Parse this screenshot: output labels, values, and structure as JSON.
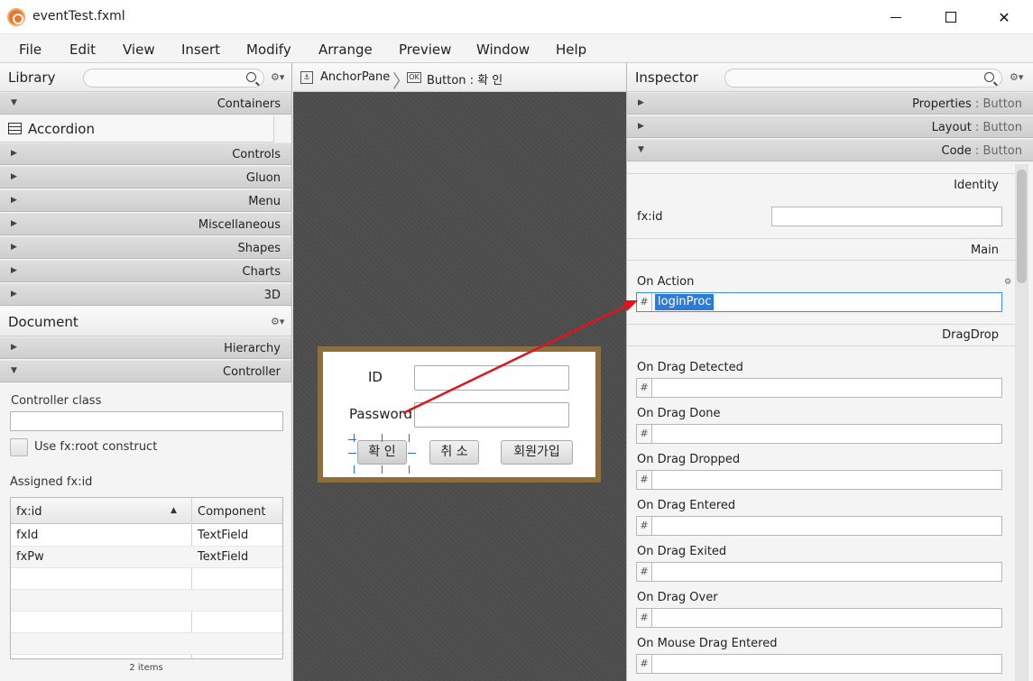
{
  "window": {
    "title": "eventTest.fxml",
    "controls": {
      "minimize": "—",
      "maximize": "☐",
      "close": "✕"
    }
  },
  "menu": [
    "File",
    "Edit",
    "View",
    "Insert",
    "Modify",
    "Arrange",
    "Preview",
    "Window",
    "Help"
  ],
  "library": {
    "title": "Library",
    "sections": [
      {
        "label": "Containers",
        "expanded": true
      },
      {
        "label": "Controls",
        "expanded": false
      },
      {
        "label": "Gluon",
        "expanded": false
      },
      {
        "label": "Menu",
        "expanded": false
      },
      {
        "label": "Miscellaneous",
        "expanded": false
      },
      {
        "label": "Shapes",
        "expanded": false
      },
      {
        "label": "Charts",
        "expanded": false
      },
      {
        "label": "3D",
        "expanded": false
      }
    ],
    "container_item": "Accordion"
  },
  "document": {
    "title": "Document",
    "sections": [
      {
        "label": "Hierarchy",
        "expanded": false
      },
      {
        "label": "Controller",
        "expanded": true
      }
    ],
    "controller_class_label": "Controller class",
    "controller_class_value": "",
    "fx_root_label": "Use fx:root construct",
    "assigned_label": "Assigned fx:id",
    "table": {
      "columns": [
        "fx:id",
        "Component"
      ],
      "rows": [
        [
          "fxId",
          "TextField"
        ],
        [
          "fxPw",
          "TextField"
        ]
      ]
    },
    "footer": "2 items"
  },
  "breadcrumb": {
    "root": "AnchorPane",
    "root_icon": "anchorpane-icon",
    "current": "Button : 확 인",
    "current_icon": "ok-button-icon",
    "current_icon_text": "OK"
  },
  "form": {
    "id_label": "ID",
    "pw_label": "Password",
    "buttons": [
      "확 인",
      "취 소",
      "회원가입"
    ]
  },
  "inspector": {
    "title": "Inspector",
    "sections": [
      {
        "label": "Properties",
        "suffix": " : Button",
        "expanded": false
      },
      {
        "label": "Layout",
        "suffix": " : Button",
        "expanded": false
      },
      {
        "label": "Code",
        "suffix": " : Button",
        "expanded": true
      }
    ],
    "identity_label": "Identity",
    "fxid_label": "fx:id",
    "fxid_value": "",
    "main_label": "Main",
    "on_action_label": "On Action",
    "on_action_value": "loginProc",
    "dragdrop_label": "DragDrop",
    "events": [
      "On Drag Detected",
      "On Drag Done",
      "On Drag Dropped",
      "On Drag Entered",
      "On Drag Exited",
      "On Drag Over",
      "On Mouse Drag Entered"
    ],
    "hash_symbol": "#"
  },
  "colors": {
    "annotation_arrow": "#e0141b",
    "selection": "#2f7bd3",
    "frame": "#8c6f3c"
  }
}
